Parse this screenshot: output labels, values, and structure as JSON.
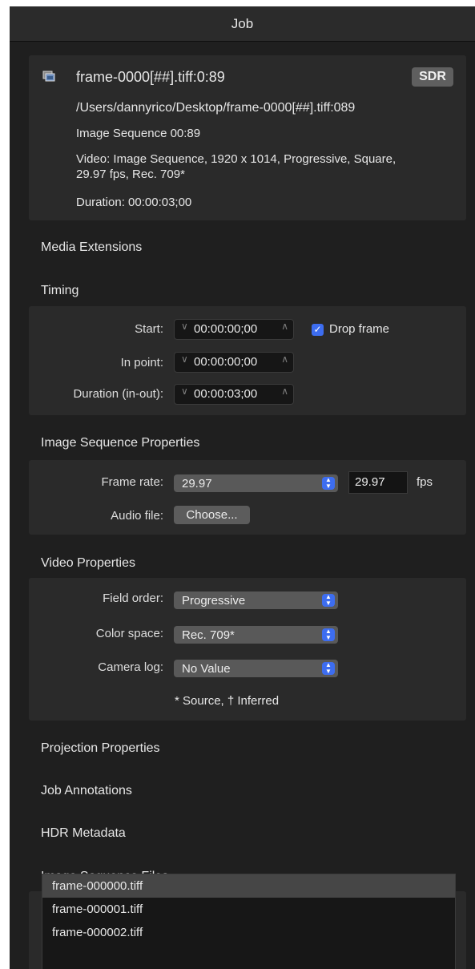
{
  "window": {
    "title": "Job"
  },
  "source": {
    "icon": "image-sequence-icon",
    "name": "frame-0000[##].tiff:0:89",
    "badge": "SDR",
    "path": "/Users/dannyrico/Desktop/frame-0000[##].tiff:089",
    "type": "Image Sequence 00:89",
    "video_line1": "Video: Image Sequence, 1920 x 1014, Progressive, Square,",
    "video_line2": "29.97 fps, Rec. 709*",
    "duration": "Duration: 00:00:03;00"
  },
  "sections": {
    "media_extensions": "Media Extensions",
    "timing": "Timing",
    "image_sequence_properties": "Image Sequence Properties",
    "video_properties": "Video Properties",
    "projection_properties": "Projection Properties",
    "job_annotations": "Job Annotations",
    "hdr_metadata": "HDR Metadata",
    "image_sequence_files": "Image Sequence Files"
  },
  "timing": {
    "start_label": "Start:",
    "start_value": "00:00:00;00",
    "drop_frame_label": "Drop frame",
    "drop_frame_checked": true,
    "in_point_label": "In point:",
    "in_point_value": "00:00:00;00",
    "duration_label": "Duration (in-out):",
    "duration_value": "00:00:03;00",
    "stepper_down": "∨",
    "stepper_up": "∧"
  },
  "image_sequence": {
    "frame_rate_label": "Frame rate:",
    "frame_rate_selected": "29.97",
    "frame_rate_field": "29.97",
    "fps_unit": "fps",
    "audio_file_label": "Audio file:",
    "choose_button": "Choose..."
  },
  "video": {
    "field_order_label": "Field order:",
    "field_order_value": "Progressive",
    "color_space_label": "Color space:",
    "color_space_value": "Rec. 709*",
    "camera_log_label": "Camera log:",
    "camera_log_value": "No Value",
    "footnote": "* Source, † Inferred"
  },
  "files": [
    "frame-000000.tiff",
    "frame-000001.tiff",
    "frame-000002.tiff"
  ],
  "colors": {
    "accent": "#3d6df0",
    "panel": "#2a2a2a",
    "background": "#1f1f1f"
  }
}
